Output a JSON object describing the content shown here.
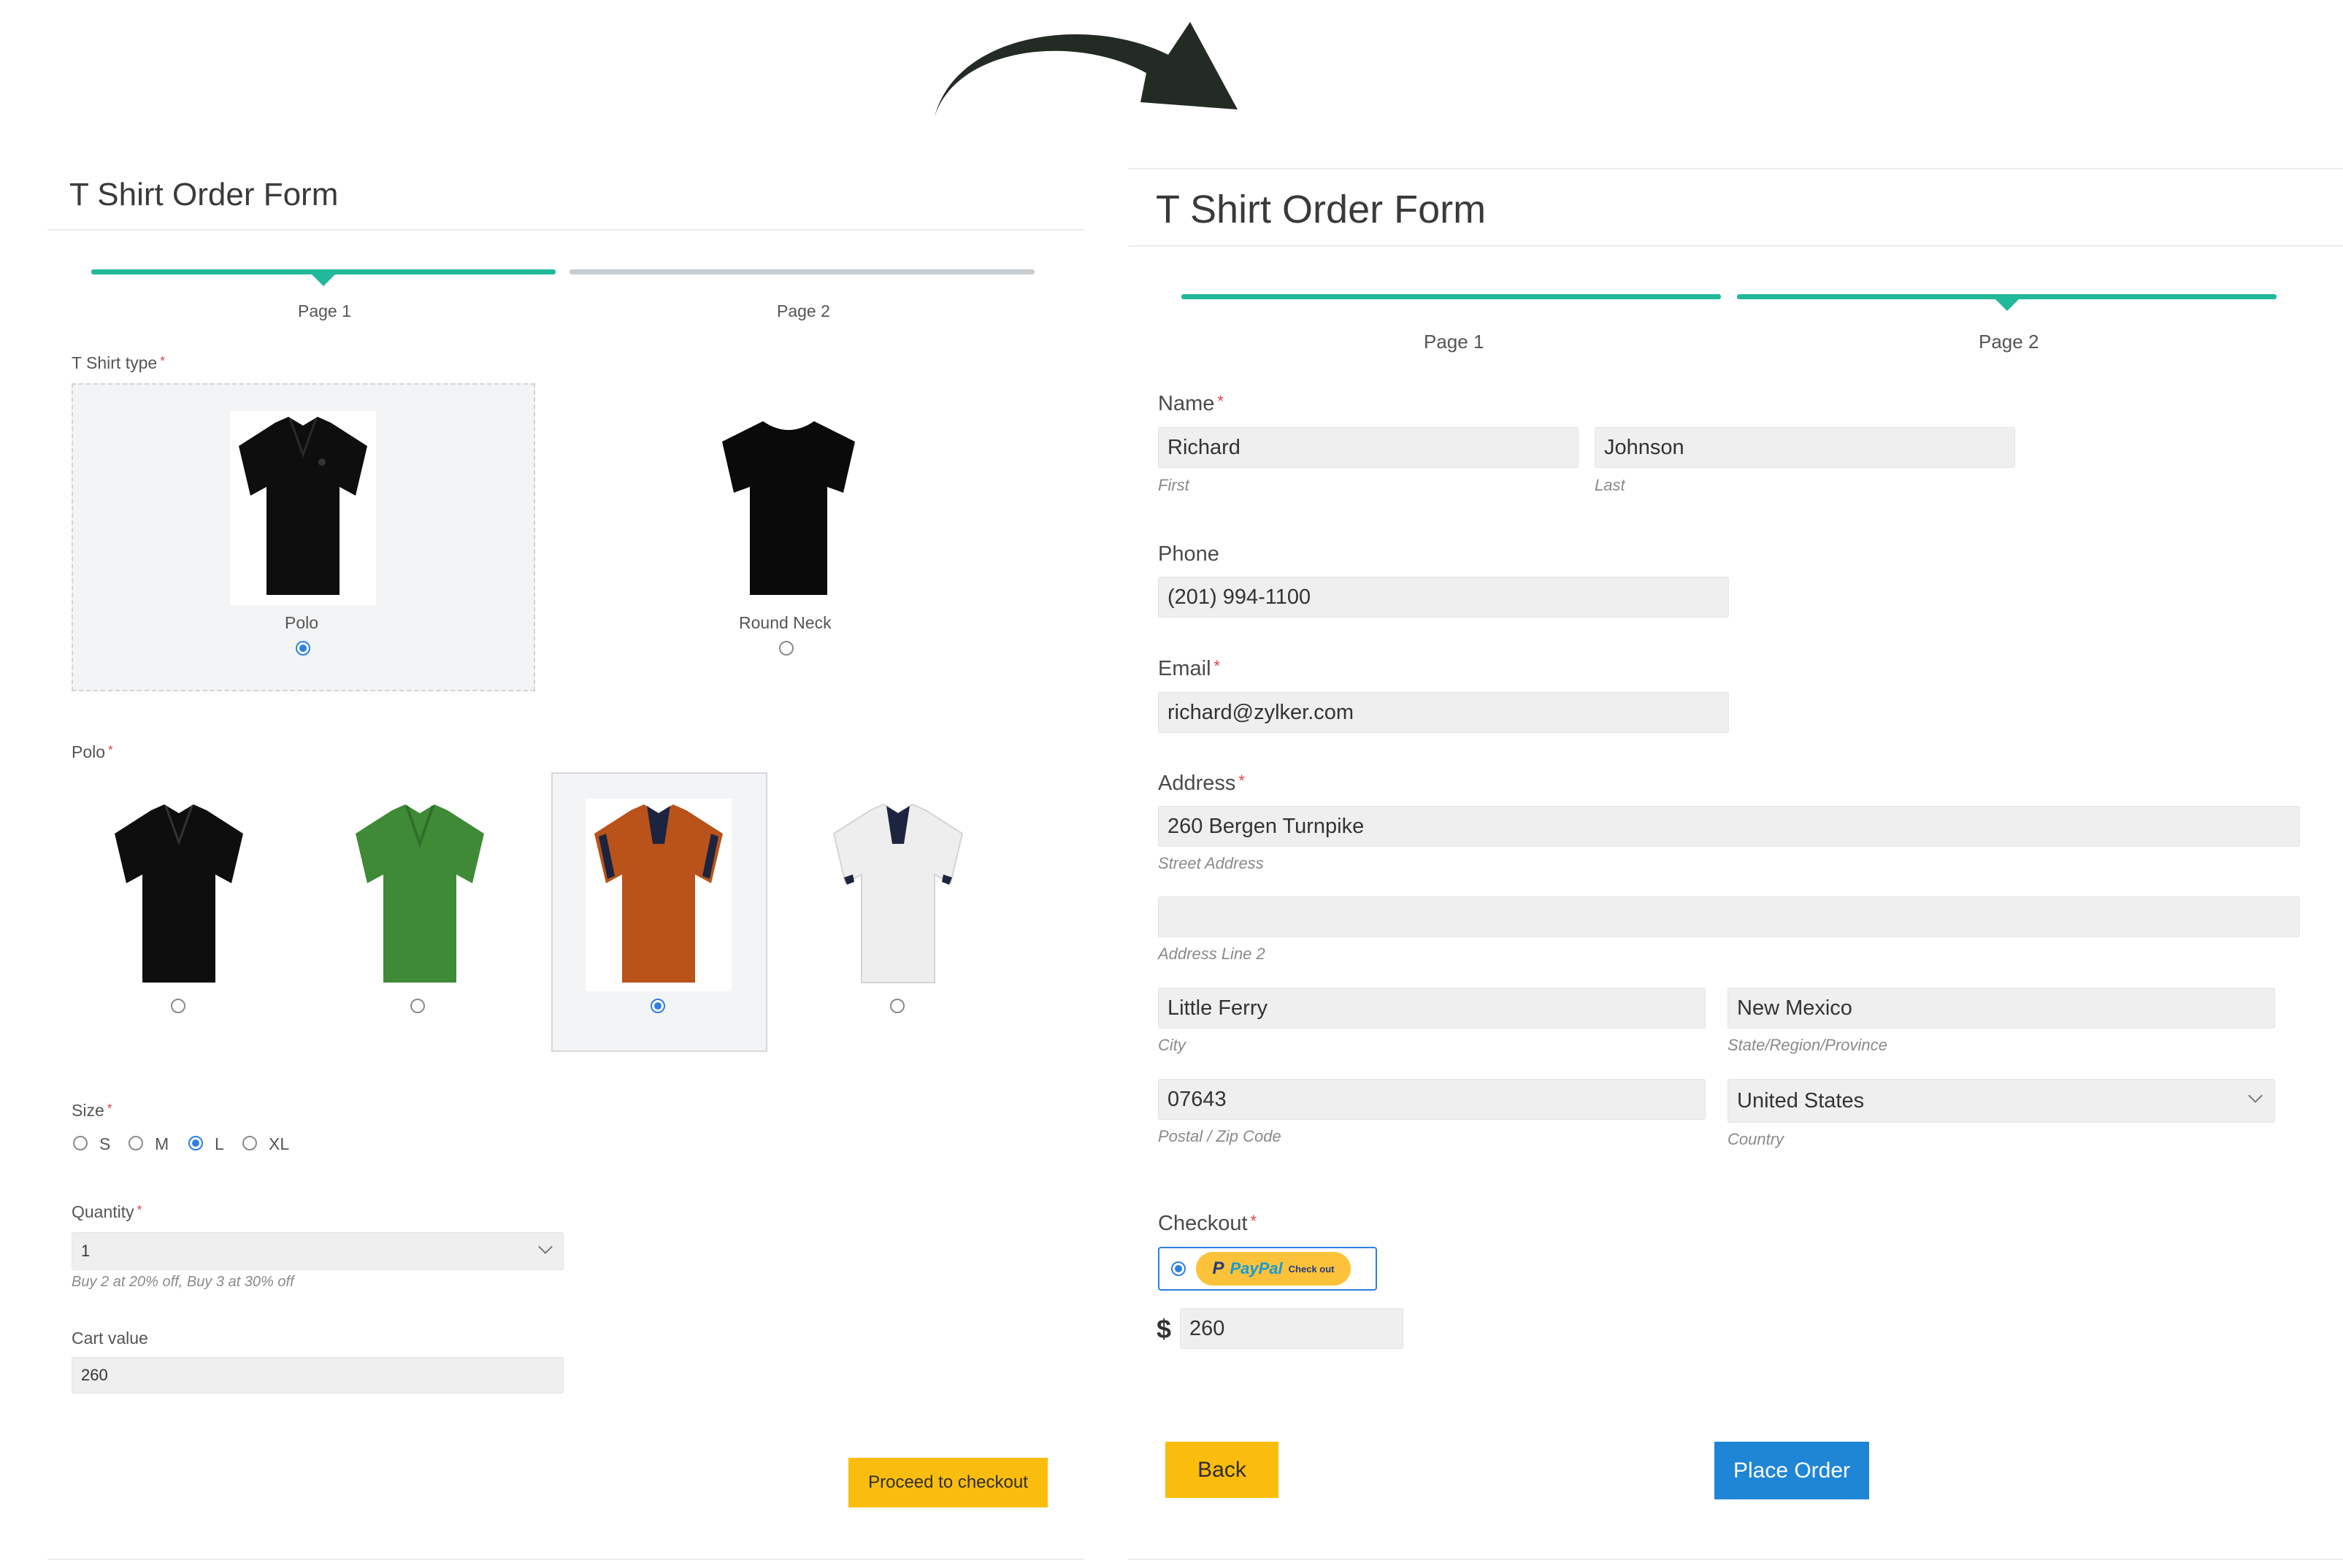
{
  "step1": {
    "form_title": "T Shirt Order Form",
    "steps": [
      {
        "label": "Page 1"
      },
      {
        "label": "Page 2"
      }
    ],
    "tshirt_type": {
      "label": "T Shirt type",
      "options": [
        {
          "label": "Polo",
          "selected": true
        },
        {
          "label": "Round Neck",
          "selected": false
        }
      ]
    },
    "polo": {
      "label": "Polo",
      "options": [
        {
          "color": "#0e0e0e",
          "collar": "#0e0e0e",
          "selected": false
        },
        {
          "color": "#3f8a37",
          "collar": "#2f6f2a",
          "selected": false
        },
        {
          "color": "#b9531a",
          "collar": "#1d2440",
          "selected": true
        },
        {
          "color": "#eeeeee",
          "collar": "#1d2440",
          "selected": false
        }
      ]
    },
    "size": {
      "label": "Size",
      "options": [
        {
          "label": "S",
          "selected": false
        },
        {
          "label": "M",
          "selected": false
        },
        {
          "label": "L",
          "selected": true
        },
        {
          "label": "XL",
          "selected": false
        }
      ]
    },
    "quantity": {
      "label": "Quantity",
      "value": "1",
      "hint": "Buy 2 at 20% off, Buy 3 at 30% off"
    },
    "cart": {
      "label": "Cart value",
      "value": "260"
    },
    "proceed_label": "Proceed to checkout"
  },
  "step2": {
    "form_title": "T Shirt Order Form",
    "steps": [
      {
        "label": "Page 1"
      },
      {
        "label": "Page 2"
      }
    ],
    "name": {
      "label": "Name",
      "first_value": "Richard",
      "first_sub": "First",
      "last_value": "Johnson",
      "last_sub": "Last"
    },
    "phone": {
      "label": "Phone",
      "value": "(201) 994-1100"
    },
    "email": {
      "label": "Email",
      "value": "richard@zylker.com"
    },
    "address": {
      "label": "Address",
      "street_value": "260 Bergen Turnpike",
      "street_sub": "Street Address",
      "line2_value": "",
      "line2_sub": "Address Line 2",
      "city_value": "Little Ferry",
      "city_sub": "City",
      "state_value": "New Mexico",
      "state_sub": "State/Region/Province",
      "zip_value": "07643",
      "zip_sub": "Postal / Zip Code",
      "country_value": "United States",
      "country_sub": "Country"
    },
    "checkout": {
      "label": "Checkout",
      "paypal_brand": "PayPal",
      "paypal_action": "Check out",
      "currency": "$",
      "amount": "260"
    },
    "back_label": "Back",
    "place_order_label": "Place Order"
  },
  "colors": {
    "accent_teal": "#21b99a",
    "required_red": "#e14343",
    "button_yellow": "#fbbd0d",
    "button_blue": "#1f86d6",
    "radio_blue": "#2d7fe3",
    "arrow": "#232b24"
  }
}
